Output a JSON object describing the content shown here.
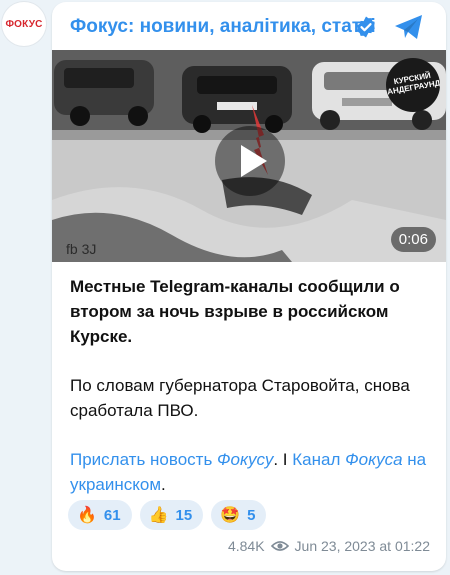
{
  "channel": {
    "avatar_text": "ФОКУС",
    "name": "Фокус: новини, аналітика, статті"
  },
  "video": {
    "duration": "0:06",
    "watermark_text": "КУРСКИЙ АНДЕГРАУНД"
  },
  "post": {
    "para1": "Местные Telegram-каналы сообщили о втором за ночь взрыве в российском Курске.",
    "para2": "По словам губернатора Старовойта, снова сработала ПВО.",
    "link1_text": "Прислать новость ",
    "link1_italic": "Фокусу",
    "sep": ". I ",
    "link2_text": "Канал ",
    "link2_italic": "Фокуса",
    "link2_tail": " на украинском",
    "end": "."
  },
  "reactions": [
    {
      "emoji": "🔥",
      "icon": "fire-icon",
      "count": "61"
    },
    {
      "emoji": "👍",
      "icon": "thumbs-up-icon",
      "count": "15"
    },
    {
      "emoji": "🤩",
      "icon": "star-struck-icon",
      "count": "5"
    }
  ],
  "meta": {
    "views": "4.84K",
    "date": "Jun 23, 2023 at 01:22"
  },
  "colors": {
    "accent": "#3390ec",
    "avatar_red": "#d7262e",
    "background": "#ecf3f8"
  }
}
